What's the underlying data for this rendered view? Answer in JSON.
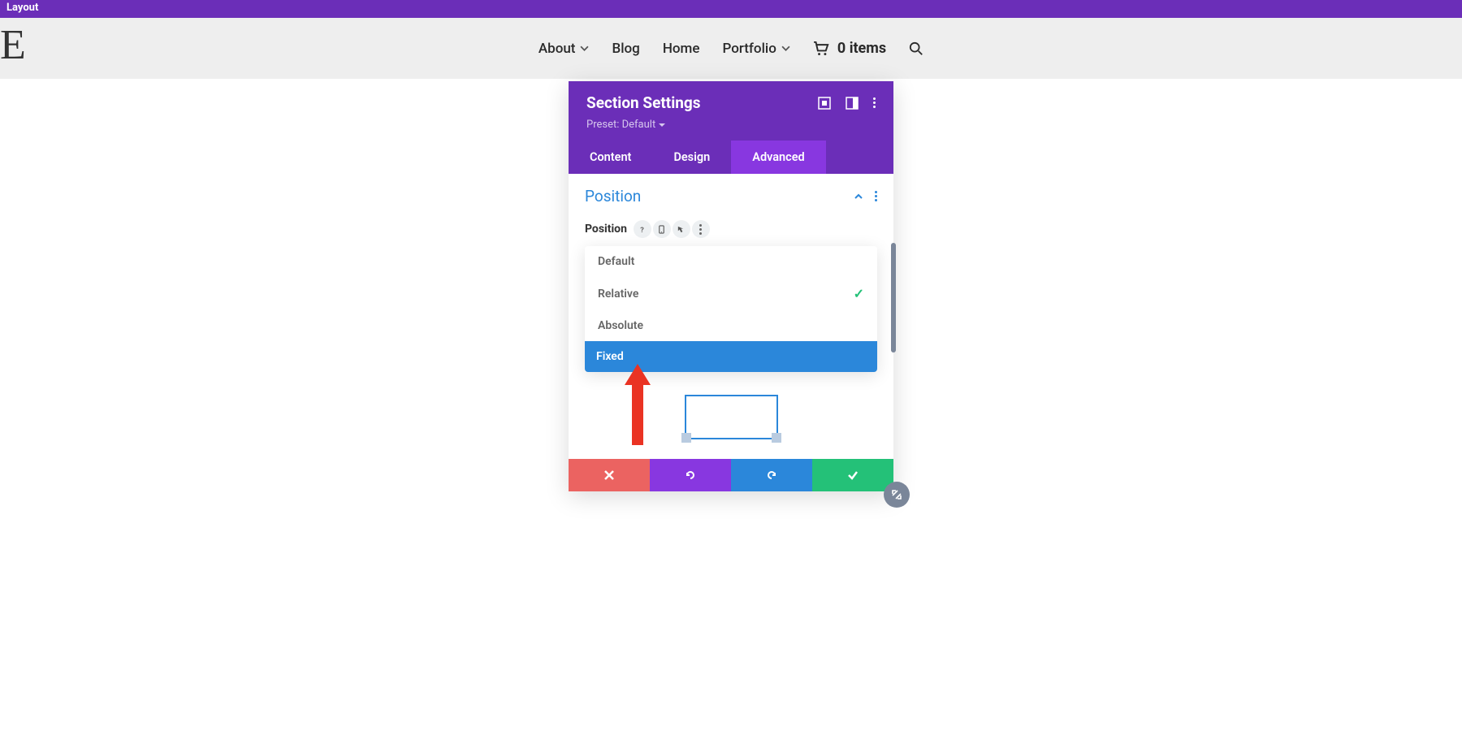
{
  "top_bar": {
    "label": "Layout"
  },
  "nav": {
    "items": [
      {
        "label": "About",
        "has_submenu": true
      },
      {
        "label": "Blog",
        "has_submenu": false
      },
      {
        "label": "Home",
        "has_submenu": false
      },
      {
        "label": "Portfolio",
        "has_submenu": true
      }
    ],
    "cart": {
      "count_label": "0 items"
    }
  },
  "panel": {
    "title": "Section Settings",
    "preset_label": "Preset: Default",
    "tabs": [
      {
        "label": "Content",
        "active": false
      },
      {
        "label": "Design",
        "active": false
      },
      {
        "label": "Advanced",
        "active": true
      }
    ],
    "section": {
      "heading": "Position",
      "field_label": "Position",
      "options": [
        {
          "label": "Default",
          "selected": false,
          "highlighted": false
        },
        {
          "label": "Relative",
          "selected": true,
          "highlighted": false
        },
        {
          "label": "Absolute",
          "selected": false,
          "highlighted": false
        },
        {
          "label": "Fixed",
          "selected": false,
          "highlighted": true
        }
      ]
    }
  },
  "colors": {
    "brand_purple": "#6b2eb8",
    "accent_purple": "#8837e0",
    "blue": "#2b87da",
    "green": "#24c178",
    "red": "#eb6361",
    "annotation_red": "#ea3323"
  }
}
